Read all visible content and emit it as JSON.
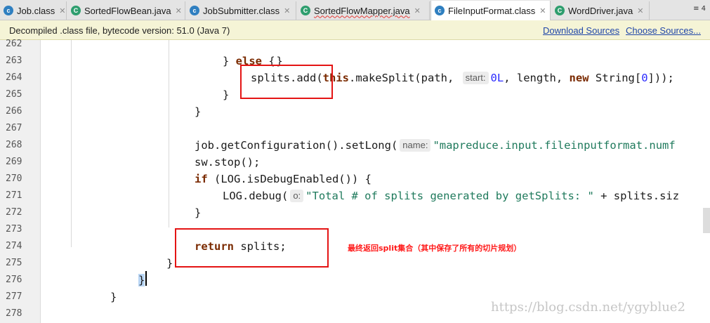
{
  "tabs": [
    {
      "label": "Job.class",
      "icon": "class-file-icon"
    },
    {
      "label": "SortedFlowBean.java",
      "icon": "java-class-icon"
    },
    {
      "label": "JobSubmitter.class",
      "icon": "class-file-icon"
    },
    {
      "label": "SortedFlowMapper.java",
      "icon": "java-class-icon"
    },
    {
      "label": "FileInputFormat.class",
      "icon": "class-file-icon",
      "active": true
    },
    {
      "label": "WordDriver.java",
      "icon": "java-class-icon"
    }
  ],
  "tab_overflow": "≡ 4",
  "banner": {
    "text": "Decompiled .class file, bytecode version: 51.0 (Java 7)",
    "download_sources": "Download Sources",
    "choose_sources": "Choose Sources..."
  },
  "line_numbers": [
    "262",
    "263",
    "264",
    "265",
    "266",
    "267",
    "268",
    "269",
    "270",
    "271",
    "272",
    "273",
    "274",
    "275",
    "276",
    "277",
    "278"
  ],
  "code": {
    "l262_brace": "}",
    "l263_brace": "} ",
    "l263_else": "else",
    "l263_open": " {",
    "l264_a": "splits.add(",
    "l264_this": "this",
    "l264_b": ".makeSplit(path, ",
    "l264_hint": "start:",
    "l264_num": "0L",
    "l264_c": ", length, ",
    "l264_new": "new",
    "l264_d": " String[",
    "l264_num2": "0",
    "l264_e": "]));",
    "l265_brace": "}",
    "l266_brace": "}",
    "l268_a": "job.getConfiguration().setLong(",
    "l268_hint": "name:",
    "l268_str": "\"mapreduce.input.fileinputformat.numf",
    "l269": "sw.stop();",
    "l270_if": "if",
    "l270_rest": " (LOG.isDebugEnabled()) {",
    "l271_a": "LOG.debug(",
    "l271_hint": "o:",
    "l271_str": "\"Total # of splits generated by getSplits: \"",
    "l271_b": " + splits.siz",
    "l272_brace": "}",
    "l274_return": "return",
    "l274_rest": " splits;",
    "l275_brace": "}",
    "l276_brace": "}",
    "l277_brace": "}"
  },
  "annotation": "最终返回split集合（其中保存了所有的切片规划）",
  "watermark": "https://blog.csdn.net/ygyblue2",
  "colors": {
    "keyword": "#1a1aa6",
    "string": "#1f7a5c",
    "number": "#2a2aff",
    "annotation_red": "#e41414",
    "banner_bg": "#f5f4d6"
  }
}
